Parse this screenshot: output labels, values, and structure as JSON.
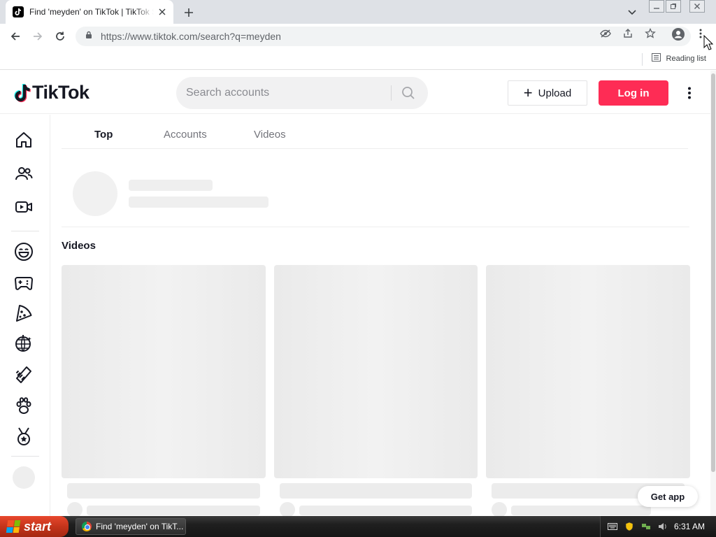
{
  "browser": {
    "tab_title": "Find 'meyden' on TikTok | TikTok Search",
    "url": "https://www.tiktok.com/search?q=meyden",
    "reading_list_label": "Reading list"
  },
  "header": {
    "logo_text": "TikTok",
    "search_placeholder": "Search accounts",
    "upload_label": "Upload",
    "upload_plus": "+",
    "login_label": "Log in"
  },
  "tabs": [
    {
      "label": "Top",
      "active": true
    },
    {
      "label": "Accounts",
      "active": false
    },
    {
      "label": "Videos",
      "active": false
    }
  ],
  "sidebar": {
    "icons": [
      "home-icon",
      "following-icon",
      "live-icon",
      "comedy-icon",
      "gaming-icon",
      "food-icon",
      "dance-icon",
      "beauty-icon",
      "animals-icon",
      "sports-icon"
    ]
  },
  "main": {
    "videos_heading": "Videos",
    "get_app_label": "Get app"
  },
  "taskbar": {
    "start_label": "start",
    "task_label": "Find 'meyden' on TikT...",
    "clock": "6:31 AM"
  },
  "colors": {
    "brand_red": "#fe2c55",
    "text_primary": "#161823",
    "tab_inactive": "#73747b"
  }
}
